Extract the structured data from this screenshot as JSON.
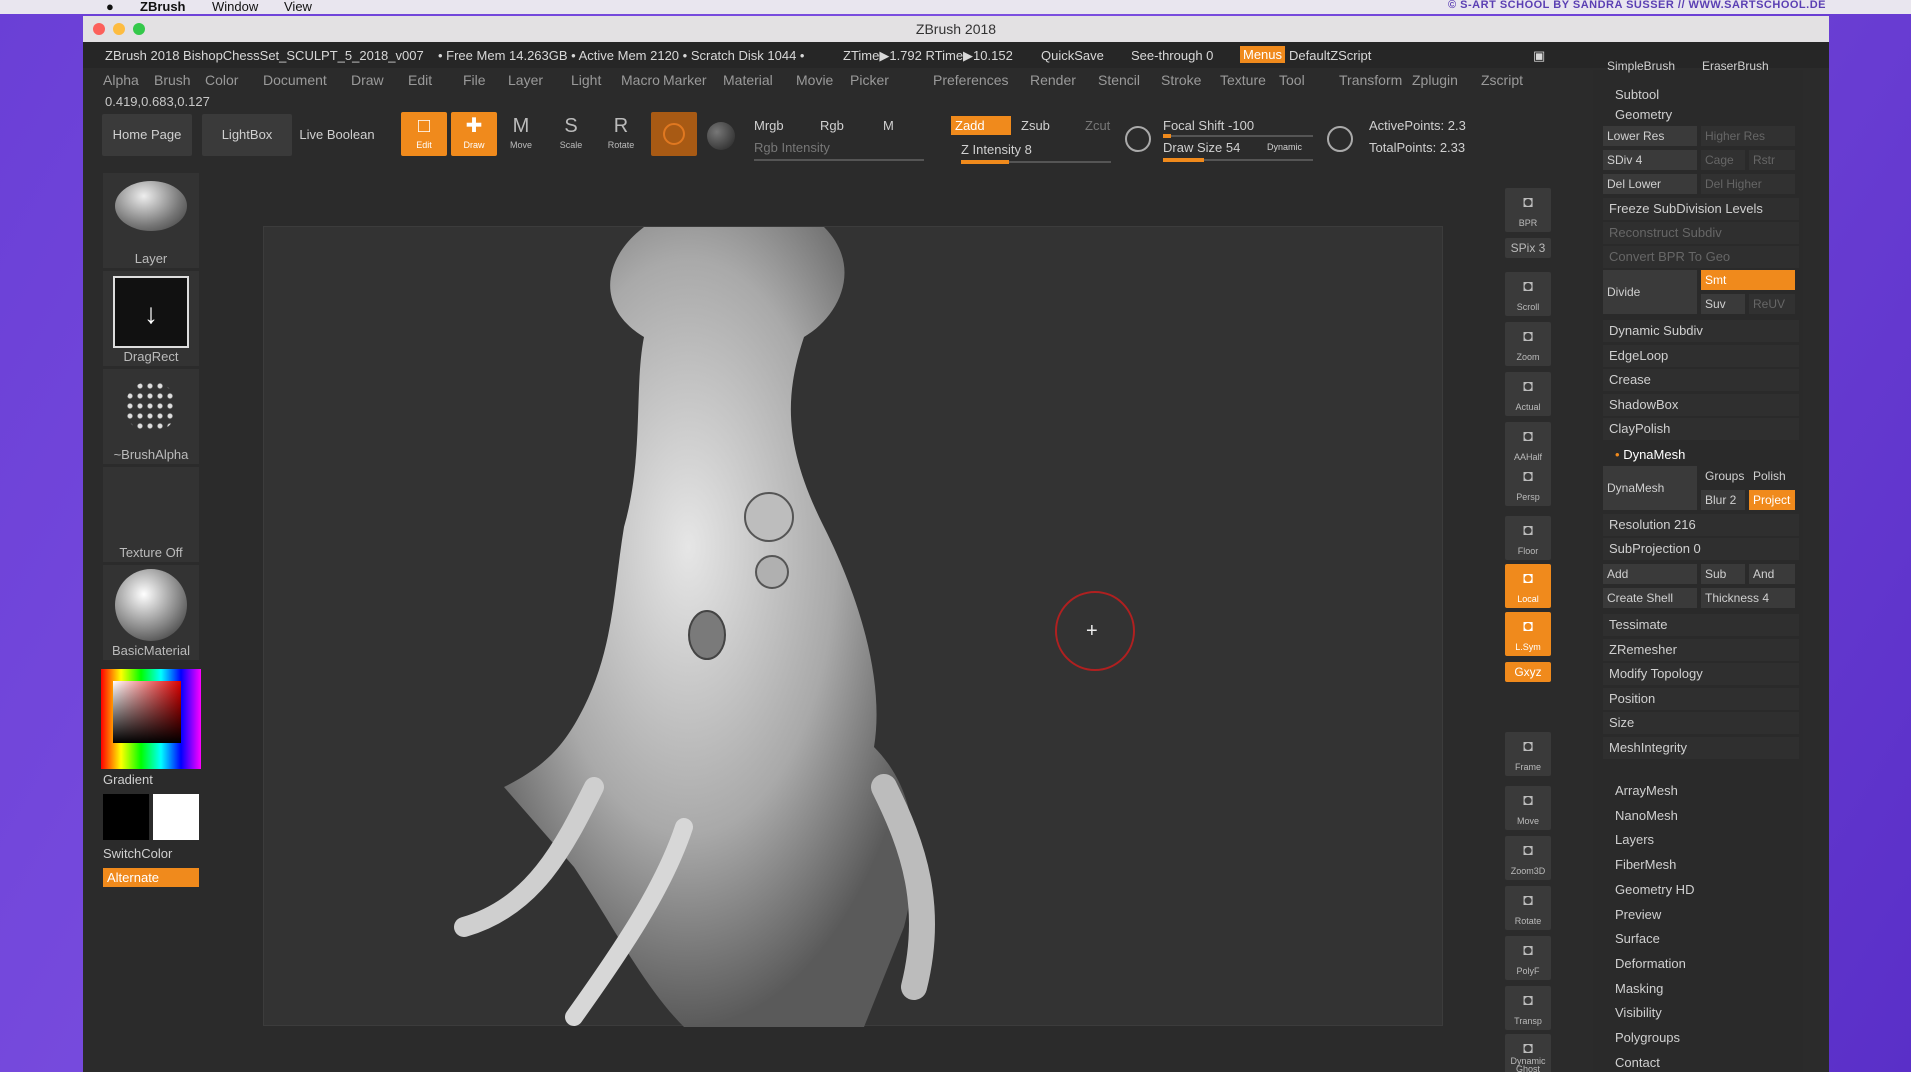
{
  "mac_menu": {
    "app": "ZBrush",
    "window": "Window",
    "view": "View"
  },
  "credit": "© S-ART SCHOOL BY SANDRA SUSSER // WWW.SARTSCHOOL.DE",
  "window_title": "ZBrush 2018",
  "info": {
    "project": "ZBrush 2018 BishopChessSet_SCULPT_5_2018_v007",
    "free_mem": "• Free Mem 14.263GB • Active Mem 2120 • Scratch Disk 1044 •",
    "ztime": "ZTime▶1.792 RTime▶10.152",
    "quicksave": "QuickSave",
    "see_through": "See-through  0",
    "menus": "Menus",
    "default_zscript": "DefaultZScript"
  },
  "menus": [
    "Alpha",
    "Brush",
    "Color",
    "Document",
    "Draw",
    "Edit",
    "File",
    "Layer",
    "Light",
    "Macro",
    "Marker",
    "Material",
    "Movie",
    "Picker",
    "Preferences",
    "Render",
    "Stencil",
    "Stroke",
    "Texture",
    "Tool",
    "Transform",
    "Zplugin",
    "Zscript"
  ],
  "coords": "0.419,0.683,0.127",
  "shelf": {
    "home_page": "Home Page",
    "lightbox": "LightBox",
    "live_boolean": "Live Boolean",
    "edit": "Edit",
    "draw": "Draw",
    "move": "Move",
    "scale": "Scale",
    "rotate": "Rotate",
    "mrgb": "Mrgb",
    "rgb": "Rgb",
    "m": "M",
    "rgb_intensity": "Rgb Intensity",
    "zadd": "Zadd",
    "zsub": "Zsub",
    "zcut": "Zcut",
    "z_intensity": "Z Intensity 8",
    "focal_shift": "Focal Shift -100",
    "draw_size": "Draw Size 54",
    "dynamic": "Dynamic",
    "active_points": "ActivePoints: 2.3",
    "total_points": "TotalPoints: 2.33"
  },
  "left": {
    "layer": "Layer",
    "dragrect": "DragRect",
    "brushalpha": "~BrushAlpha",
    "texture_off": "Texture Off",
    "basic_material": "BasicMaterial",
    "gradient": "Gradient",
    "switchcolor": "SwitchColor",
    "alternate": "Alternate"
  },
  "right_shelf": [
    "BPR",
    "SPix 3",
    "Scroll",
    "Zoom",
    "Actual",
    "AAHalf",
    "Persp",
    "Floor",
    "Local",
    "L.Sym",
    "Gxyz",
    "Frame",
    "Move",
    "Zoom3D",
    "Rotate",
    "PolyF",
    "Transp",
    "Ghost",
    "Dynamic"
  ],
  "panel": {
    "simple_brush": "SimpleBrush",
    "eraser_brush": "EraserBrush",
    "subtool": "Subtool",
    "geometry": "Geometry",
    "lower_res": "Lower Res",
    "higher_res": "Higher Res",
    "sdiv": "SDiv 4",
    "cage": "Cage",
    "rstr": "Rstr",
    "del_lower": "Del Lower",
    "del_higher": "Del Higher",
    "freeze": "Freeze SubDivision Levels",
    "reconstruct": "Reconstruct Subdiv",
    "convert_bpr": "Convert BPR To Geo",
    "divide": "Divide",
    "smt": "Smt",
    "suv": "Suv",
    "reuv": "ReUV",
    "items1": [
      "Dynamic Subdiv",
      "EdgeLoop",
      "Crease",
      "ShadowBox",
      "ClayPolish"
    ],
    "dynamesh_header": "DynaMesh",
    "dynamesh": "DynaMesh",
    "groups": "Groups",
    "polish": "Polish",
    "blur": "Blur 2",
    "project": "Project",
    "resolution": "Resolution 216",
    "subprojection": "SubProjection 0",
    "add": "Add",
    "sub": "Sub",
    "and": "And",
    "create_shell": "Create Shell",
    "thickness": "Thickness 4",
    "items2": [
      "Tessimate",
      "ZRemesher",
      "Modify Topology",
      "Position",
      "Size",
      "MeshIntegrity"
    ],
    "sections": [
      "ArrayMesh",
      "NanoMesh",
      "Layers",
      "FiberMesh",
      "Geometry HD",
      "Preview",
      "Surface",
      "Deformation",
      "Masking",
      "Visibility",
      "Polygroups",
      "Contact"
    ]
  },
  "colors": {
    "accent": "#f08a1c",
    "bg": "#2b2b2b"
  }
}
